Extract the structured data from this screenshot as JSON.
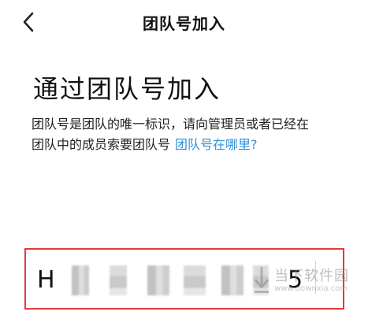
{
  "nav": {
    "title": "团队号加入",
    "back_icon": "chevron-left-icon"
  },
  "main": {
    "heading": "通过团队号加入",
    "description_line1": "团队号是团队的唯一标识，请向管理员或者已经在",
    "description_line2": "团队中的成员索要团队号",
    "help_link": "团队号在哪里?",
    "link_color": "#2f8fd6"
  },
  "code_input": {
    "first_char": "H",
    "last_char": "5",
    "border_color": "#e23b3b"
  },
  "watermark": {
    "text": "当下软件园",
    "url": "www.downxia.com"
  }
}
